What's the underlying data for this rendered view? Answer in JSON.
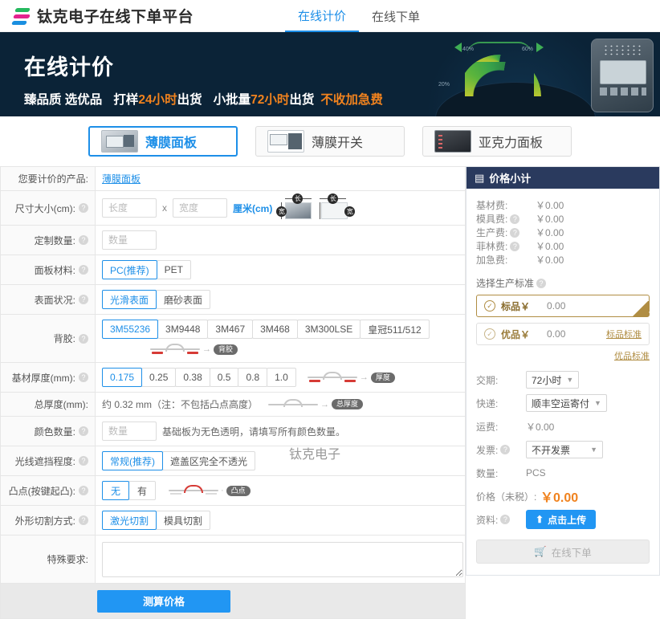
{
  "topnav": {
    "brand": "钛克电子在线下单平台",
    "links": [
      {
        "label": "在线计价",
        "active": true
      },
      {
        "label": "在线下单",
        "active": false
      }
    ]
  },
  "banner": {
    "title": "在线计价",
    "sub_1": "臻品质 选优品",
    "sub_2a": "打样",
    "sub_2b": "24小时",
    "sub_2c": "出货",
    "sub_3a": "小批量",
    "sub_3b": "72小时",
    "sub_3c": "出货",
    "sub_4": "不收加急费",
    "dial_ticks": [
      "20%",
      "40%",
      "60%"
    ]
  },
  "product_tabs": [
    {
      "label": "薄膜面板",
      "active": true
    },
    {
      "label": "薄膜开关",
      "active": false
    },
    {
      "label": "亚克力面板",
      "active": false
    }
  ],
  "watermark": "钛克电子",
  "form": {
    "product_row": {
      "label": "您要计价的产品:",
      "value": "薄膜面板"
    },
    "size_row": {
      "label": "尺寸大小(cm):",
      "length_placeholder": "长度",
      "separator": "x",
      "width_placeholder": "宽度",
      "unit": "厘米(cm)",
      "badge_length": "长",
      "badge_width": "宽"
    },
    "qty_row": {
      "label": "定制数量:",
      "placeholder": "数量"
    },
    "material_row": {
      "label": "面板材料:",
      "options": [
        "PC(推荐)",
        "PET"
      ],
      "selected": 0
    },
    "surface_row": {
      "label": "表面状况:",
      "options": [
        "光滑表面",
        "磨砂表面"
      ],
      "selected": 0
    },
    "adhesive_row": {
      "label": "背胶:",
      "options": [
        "3M55236",
        "3M9448",
        "3M467",
        "3M468",
        "3M300LSE",
        "皇冠511/512"
      ],
      "selected": 0,
      "diagram_pill": "背胶"
    },
    "base_thickness_row": {
      "label": "基材厚度(mm):",
      "options": [
        "0.175",
        "0.25",
        "0.38",
        "0.5",
        "0.8",
        "1.0"
      ],
      "selected": 0,
      "diagram_pill": "厚度"
    },
    "total_thickness_row": {
      "label": "总厚度(mm):",
      "value": "约 0.32 mm（注：不包括凸点高度）",
      "diagram_pill": "总厚度"
    },
    "color_count_row": {
      "label": "颜色数量:",
      "placeholder": "数量",
      "note": "基础板为无色透明，请填写所有颜色数量。"
    },
    "light_block_row": {
      "label": "光线遮挡程度:",
      "options": [
        "常规(推荐)",
        "遮盖区完全不透光"
      ],
      "selected": 0
    },
    "emboss_row": {
      "label": "凸点(按键起凸):",
      "options": [
        "无",
        "有"
      ],
      "selected": 0,
      "diagram_pill": "凸点"
    },
    "cut_row": {
      "label": "外形切割方式:",
      "options": [
        "激光切割",
        "模具切割"
      ],
      "selected": 0
    },
    "special_row": {
      "label": "特殊要求:",
      "placeholder": ""
    },
    "calc_button": "测算价格"
  },
  "summary": {
    "header": "价格小计",
    "fees": [
      {
        "label": "基材费:",
        "has_help": false,
        "amount": "￥0.00"
      },
      {
        "label": "模具费:",
        "has_help": true,
        "amount": "￥0.00"
      },
      {
        "label": "生产费:",
        "has_help": true,
        "amount": "￥0.00"
      },
      {
        "label": "菲林费:",
        "has_help": true,
        "amount": "￥0.00"
      },
      {
        "label": "加急费:",
        "has_help": false,
        "amount": "￥0.00"
      }
    ],
    "standard_title": "选择生产标准",
    "standards": [
      {
        "name": "标品￥",
        "amount": "0.00",
        "link": "",
        "active": true
      },
      {
        "name": "优品￥",
        "amount": "0.00",
        "link": "标品标准",
        "active": false
      }
    ],
    "standard_link_below": "优品标准",
    "options": [
      {
        "label": "交期:",
        "has_help": false,
        "type": "select",
        "value": "72小时"
      },
      {
        "label": "快递:",
        "has_help": false,
        "type": "select",
        "value": "顺丰空运寄付"
      },
      {
        "label": "运费:",
        "has_help": false,
        "type": "text",
        "value": "￥0.00"
      },
      {
        "label": "发票:",
        "has_help": true,
        "type": "select",
        "value": "不开发票"
      },
      {
        "label": "数量:",
        "has_help": false,
        "type": "text",
        "value": "PCS"
      }
    ],
    "price_label": "价格（未税）:",
    "price_value": "￥0.00",
    "upload_label": "资料:",
    "upload_button": "点击上传",
    "order_button": "在线下单"
  },
  "colors": {
    "accent_blue": "#1d8fe8",
    "banner_bg": "#0b2337",
    "orange": "#f0821e",
    "panel_header": "#2a3a5e",
    "gold": "#b08d43"
  }
}
